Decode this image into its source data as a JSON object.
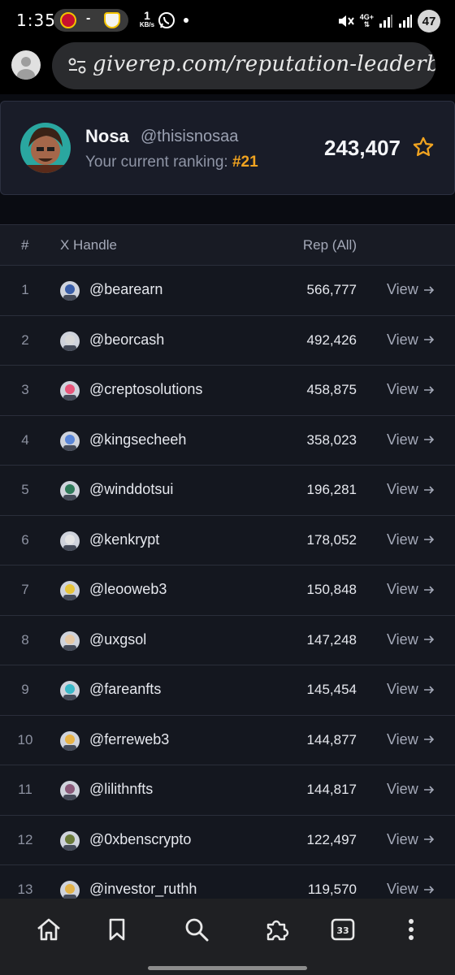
{
  "status_bar": {
    "time": "1:35",
    "score_separator": "-",
    "net_speed_value": "1",
    "net_speed_unit": "KB/s",
    "network_type": "4G+",
    "battery": "47"
  },
  "browser": {
    "url": "giverep.com/reputation-leaderboard"
  },
  "user_card": {
    "name": "Nosa",
    "handle": "@thisisnosaa",
    "ranking_label": "Your current ranking:",
    "ranking_value": "#21",
    "reputation": "243,407"
  },
  "table": {
    "headers": {
      "rank": "#",
      "handle": "X Handle",
      "rep": "Rep (All)"
    },
    "view_label": "View",
    "rows": [
      {
        "rank": "1",
        "handle": "@bearearn",
        "rep": "566,777",
        "avatar_color": "#3a5ea8"
      },
      {
        "rank": "2",
        "handle": "@beorcash",
        "rep": "492,426",
        "avatar_color": "#d8d8d8"
      },
      {
        "rank": "3",
        "handle": "@creptosolutions",
        "rep": "458,875",
        "avatar_color": "#e8557a"
      },
      {
        "rank": "4",
        "handle": "@kingsecheeh",
        "rep": "358,023",
        "avatar_color": "#5a86d8"
      },
      {
        "rank": "5",
        "handle": "@winddotsui",
        "rep": "196,281",
        "avatar_color": "#2f7a5a"
      },
      {
        "rank": "6",
        "handle": "@kenkrypt",
        "rep": "178,052",
        "avatar_color": "#e4e4e4"
      },
      {
        "rank": "7",
        "handle": "@leooweb3",
        "rep": "150,848",
        "avatar_color": "#e7c43a"
      },
      {
        "rank": "8",
        "handle": "@uxgsol",
        "rep": "147,248",
        "avatar_color": "#e6c9a6"
      },
      {
        "rank": "9",
        "handle": "@fareanfts",
        "rep": "145,454",
        "avatar_color": "#3ab8c8"
      },
      {
        "rank": "10",
        "handle": "@ferreweb3",
        "rep": "144,877",
        "avatar_color": "#e8b347"
      },
      {
        "rank": "11",
        "handle": "@lilithnfts",
        "rep": "144,817",
        "avatar_color": "#8a5a7a"
      },
      {
        "rank": "12",
        "handle": "@0xbenscrypto",
        "rep": "122,497",
        "avatar_color": "#6a7a3a"
      },
      {
        "rank": "13",
        "handle": "@investor_ruthh",
        "rep": "119,570",
        "avatar_color": "#e2b24a"
      }
    ]
  },
  "toolbar": {
    "icons": [
      "home-icon",
      "bookmark-icon",
      "search-icon",
      "extensions-icon",
      "tab-switcher-icon",
      "more-icon"
    ],
    "tab_count": "33"
  },
  "colors": {
    "accent": "#f0a320",
    "card_bg": "#191c28",
    "table_bg": "#14171f"
  }
}
